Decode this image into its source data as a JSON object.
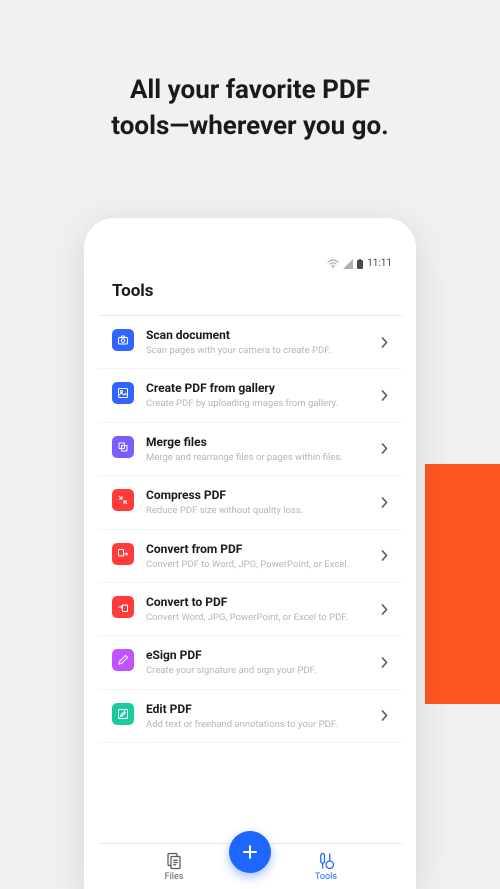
{
  "hero": {
    "line1": "All your favorite PDF",
    "line2": "tools—wherever you go."
  },
  "statusbar": {
    "time": "11:11"
  },
  "page": {
    "title": "Tools"
  },
  "tools": [
    {
      "title": "Scan document",
      "desc": "Scan pages with your camera to create PDF.",
      "color": "ic-blue",
      "icon": "camera-icon"
    },
    {
      "title": "Create PDF from gallery",
      "desc": "Create PDF by uploading images from gallery.",
      "color": "ic-blue",
      "icon": "image-icon"
    },
    {
      "title": "Merge files",
      "desc": "Merge and rearrange files or pages within files.",
      "color": "ic-purple",
      "icon": "merge-icon"
    },
    {
      "title": "Compress PDF",
      "desc": "Reduce PDF size without quality loss.",
      "color": "ic-red",
      "icon": "compress-icon"
    },
    {
      "title": "Convert from PDF",
      "desc": "Convert PDF to Word, JPG, PowerPoint, or Excel.",
      "color": "ic-red",
      "icon": "convert-from-icon"
    },
    {
      "title": "Convert to PDF",
      "desc": "Convert Word, JPG, PowerPoint, or Excel to PDF.",
      "color": "ic-red",
      "icon": "convert-to-icon"
    },
    {
      "title": "eSign PDF",
      "desc": "Create your signature and sign your PDF.",
      "color": "ic-pink",
      "icon": "sign-icon"
    },
    {
      "title": "Edit PDF",
      "desc": "Add text or freehand annotations to your PDF.",
      "color": "ic-teal",
      "icon": "edit-icon"
    }
  ],
  "tabs": {
    "files": "Files",
    "tools": "Tools"
  },
  "colors": {
    "accent": "#1e66ff",
    "brand": "#ff5722"
  }
}
